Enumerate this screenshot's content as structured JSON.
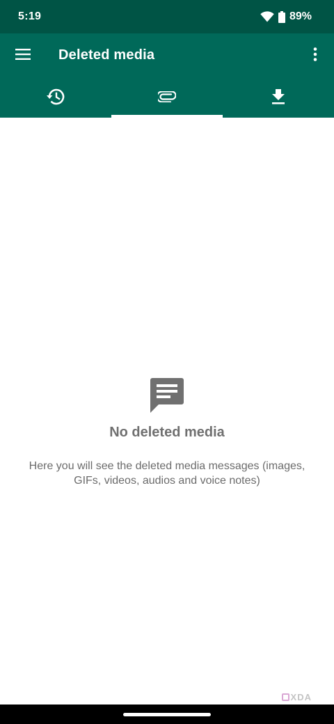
{
  "status_bar": {
    "time": "5:19",
    "battery": "89%",
    "icons": [
      "wifi-icon",
      "battery-icon"
    ]
  },
  "app_bar": {
    "title": "Deleted media",
    "menu_icon": "hamburger-menu-icon",
    "overflow_icon": "more-vert-icon"
  },
  "tabs": [
    {
      "icon": "history-icon",
      "selected": false
    },
    {
      "icon": "attachment-icon",
      "selected": true
    },
    {
      "icon": "download-icon",
      "selected": false
    }
  ],
  "empty_state": {
    "icon": "message-icon",
    "title": "No deleted media",
    "description": "Here you will see the deleted media messages (images, GIFs, videos, audios and voice notes)"
  },
  "watermark": {
    "text": "XDA"
  },
  "colors": {
    "status_bar": "#005445",
    "app_bar": "#006959",
    "icon_gray": "#707070",
    "text_gray": "#6b6b6b"
  }
}
